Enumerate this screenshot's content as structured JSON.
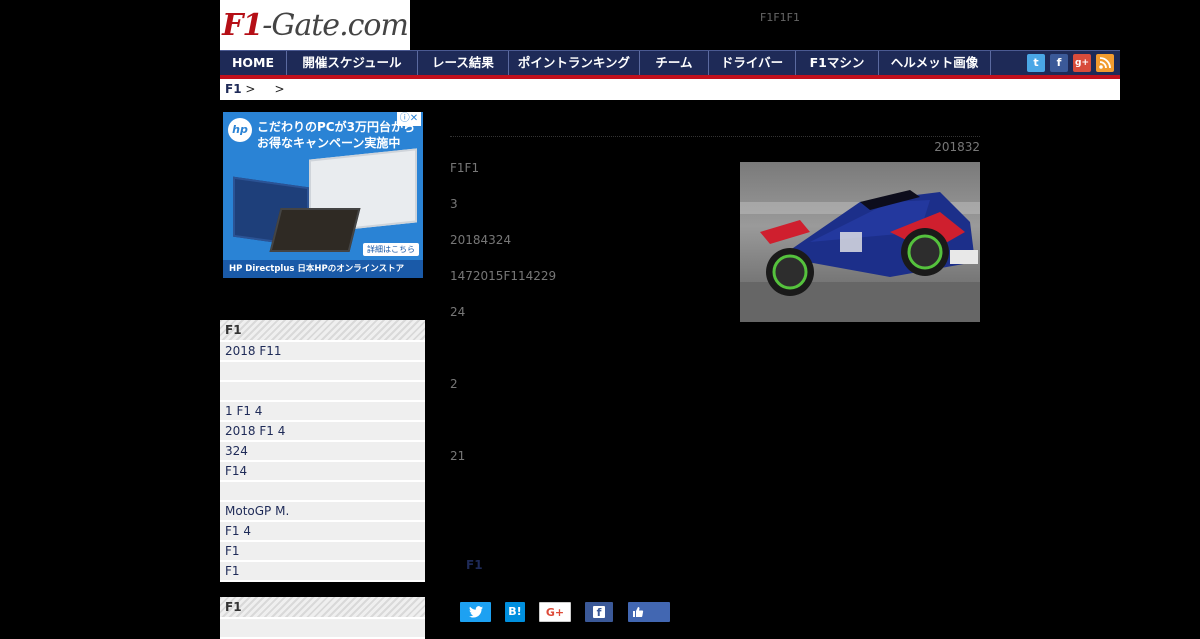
{
  "header": {
    "logo_text_red": "F1",
    "logo_text_rest": "-Gate.com",
    "tagline": "F1F1F1"
  },
  "nav": {
    "items": [
      "HOME",
      "開催スケジュール",
      "レース結果",
      "ポイントランキング",
      "チーム",
      "ドライバー",
      "F1マシン",
      "ヘルメット画像"
    ],
    "social_icons": [
      "twitter-icon",
      "facebook-icon",
      "google-plus-icon",
      "rss-icon"
    ]
  },
  "breadcrumb": {
    "root": "F1",
    "sep1": " >",
    "sep2": ">"
  },
  "ad": {
    "brand": "hp",
    "line1": "こだわりのPCが3万円台から",
    "line2": "お得なキャンペーン実施中",
    "detail": "詳細はこちら",
    "footer": "HP Directplus  日本HPのオンラインストア",
    "close": "ⓘ✕"
  },
  "sidebar": {
    "box1": {
      "header": "F1",
      "items": [
        "2018 F11",
        "",
        "",
        "1 F1 4",
        "2018 F1 4",
        "324",
        " F14",
        "",
        "MotoGP M.",
        "F1 4",
        "F1",
        " F1"
      ]
    },
    "box2": {
      "header": "F1"
    }
  },
  "article": {
    "date": "201832",
    "paragraphs": [
      "F1F1",
      "3",
      "20184324",
      "1472015F114229",
      "24",
      "2",
      "21"
    ],
    "category_link": "F1"
  },
  "share": {
    "twitter": "🐦",
    "hatena": "B!",
    "googleplus": "G+",
    "facebook": "f",
    "like": "👍"
  },
  "colors": {
    "nav_bg": "#1e2a57",
    "nav_border": "#c0101c",
    "logo_red": "#b50f16",
    "link": "#1e2a57"
  }
}
